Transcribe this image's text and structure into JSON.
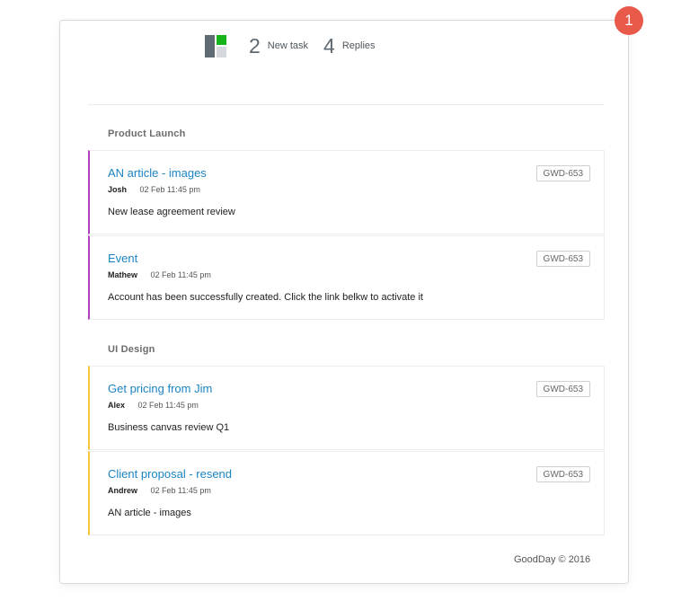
{
  "notification_badge": {
    "count": "1",
    "color": "#e8594a"
  },
  "header": {
    "icon": "board-icon",
    "icon_colors": [
      "#5f6b73",
      "#17b31b",
      "#d5d8dc"
    ],
    "new_task_count": "2",
    "new_task_label": "New task",
    "replies_count": "4",
    "replies_label": "Replies"
  },
  "groups": [
    {
      "title": "Product Launch",
      "accent_color": "#b23fc1",
      "tasks": [
        {
          "title": "AN article - images",
          "author": "Josh",
          "time": "02 Feb 11:45 pm",
          "description": "New lease agreement review",
          "tag": "GWD-653"
        },
        {
          "title": "Event",
          "author": "Mathew",
          "time": "02 Feb 11:45 pm",
          "description": "Account has been successfully created. Click the link belkw to activate it",
          "tag": "GWD-653"
        }
      ]
    },
    {
      "title": "UI Design",
      "accent_color": "#f4c43a",
      "tasks": [
        {
          "title": "Get pricing from Jim",
          "author": "Alex",
          "time": "02 Feb 11:45 pm",
          "description": "Business canvas review Q1",
          "tag": "GWD-653"
        },
        {
          "title": "Client proposal - resend",
          "author": "Andrew",
          "time": "02 Feb 11:45 pm",
          "description": "AN article - images",
          "tag": "GWD-653"
        }
      ]
    }
  ],
  "link_color": "#1a84c4",
  "footer": {
    "text": "GoodDay © 2016"
  }
}
